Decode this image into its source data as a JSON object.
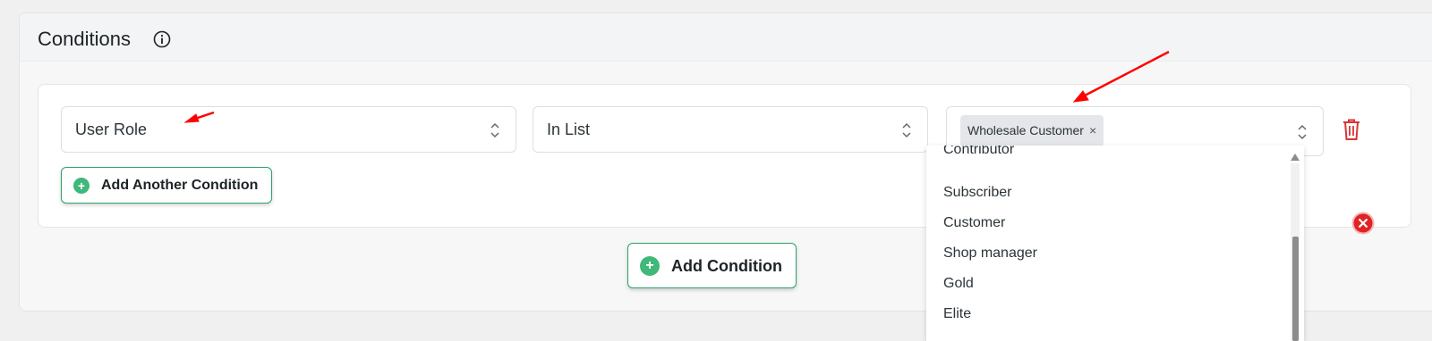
{
  "section": {
    "title": "Conditions",
    "info_icon": "info-icon"
  },
  "condition": {
    "field_value": "User Role",
    "operator_value": "In List",
    "selected_tags": [
      {
        "label": "Wholesale Customer",
        "remove_symbol": "×"
      }
    ],
    "delete_icon": "trash-icon",
    "delete_color": "#d63638"
  },
  "dropdown": {
    "options": [
      "Contributor",
      "Subscriber",
      "Customer",
      "Shop manager",
      "Gold",
      "Elite"
    ]
  },
  "buttons": {
    "add_another_label": "Add Another Condition",
    "add_condition_label": "Add Condition",
    "plus_symbol": "+"
  },
  "colors": {
    "accent_green": "#3fb87a",
    "danger_red": "#d63638",
    "annotation_red": "#ff0000"
  }
}
